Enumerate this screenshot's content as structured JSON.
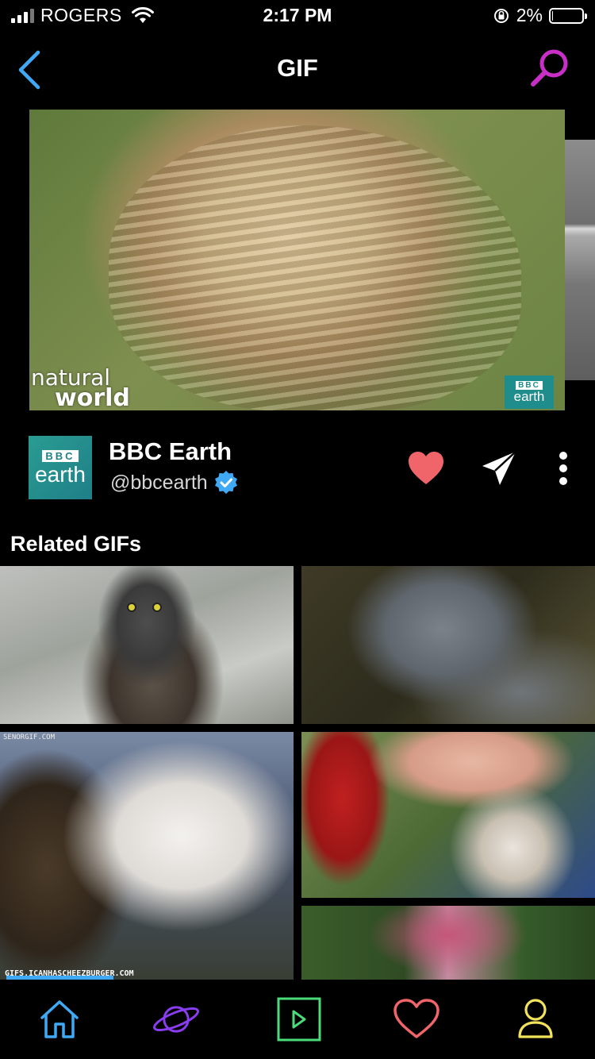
{
  "status_bar": {
    "carrier": "ROGERS",
    "time": "2:17 PM",
    "battery_percent": "2%",
    "battery_level": 0.02
  },
  "nav": {
    "title": "GIF"
  },
  "main_gif": {
    "watermark_left_line1": "natural",
    "watermark_left_line2": "world",
    "watermark_right_top": "BBC",
    "watermark_right_bottom": "earth"
  },
  "channel": {
    "avatar_top": "BBC",
    "avatar_bottom": "earth",
    "name": "BBC Earth",
    "handle": "@bbcearth",
    "verified": true
  },
  "related": {
    "title": "Related GIFs",
    "llama_caption_top": "SENORGIF.COM",
    "llama_caption_bottom": "GIFS.ICANHASCHEEZBURGER.COM",
    "llama_progress": 0.38
  },
  "colors": {
    "heart": "#f0656a",
    "search": "#c72fc6",
    "back": "#3fa9f5",
    "verified": "#3fa9f5",
    "tab_home": "#3fa9f5",
    "tab_explore": "#8a3cf0",
    "tab_video": "#4cdb7a",
    "tab_favorites": "#f0656a",
    "tab_profile": "#f2e35a"
  },
  "icons": {
    "back": "chevron-left-icon",
    "search": "search-icon",
    "like": "heart-icon",
    "share": "paper-plane-icon",
    "more": "more-vertical-icon",
    "tabs": [
      "home-icon",
      "planet-icon",
      "play-icon",
      "heart-icon",
      "user-icon"
    ]
  }
}
